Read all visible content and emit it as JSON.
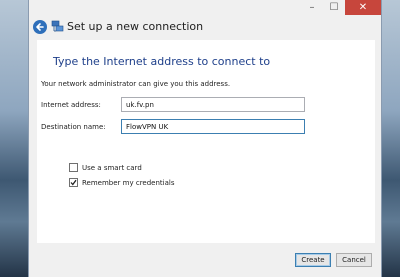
{
  "window": {
    "title": "Set up a new connection",
    "controls": {
      "minimize": "–",
      "maximize": "☐",
      "close": "✕"
    }
  },
  "page": {
    "heading": "Type the Internet address to connect to",
    "note": "Your network administrator can give you this address."
  },
  "form": {
    "internet_address": {
      "label": "Internet address:",
      "value": "uk.fv.pn"
    },
    "destination_name": {
      "label": "Destination name:",
      "value": "FlowVPN UK"
    },
    "smart_card": {
      "label": "Use a smart card",
      "checked": false
    },
    "remember_credentials": {
      "label": "Remember my credentials",
      "checked": true
    }
  },
  "buttons": {
    "create": "Create",
    "cancel": "Cancel"
  },
  "icons": {
    "back": "back-arrow-icon",
    "network": "network-connection-icon"
  },
  "colors": {
    "heading": "#1e3f8a",
    "close_button": "#c7463c",
    "back_button": "#2e6fba"
  }
}
